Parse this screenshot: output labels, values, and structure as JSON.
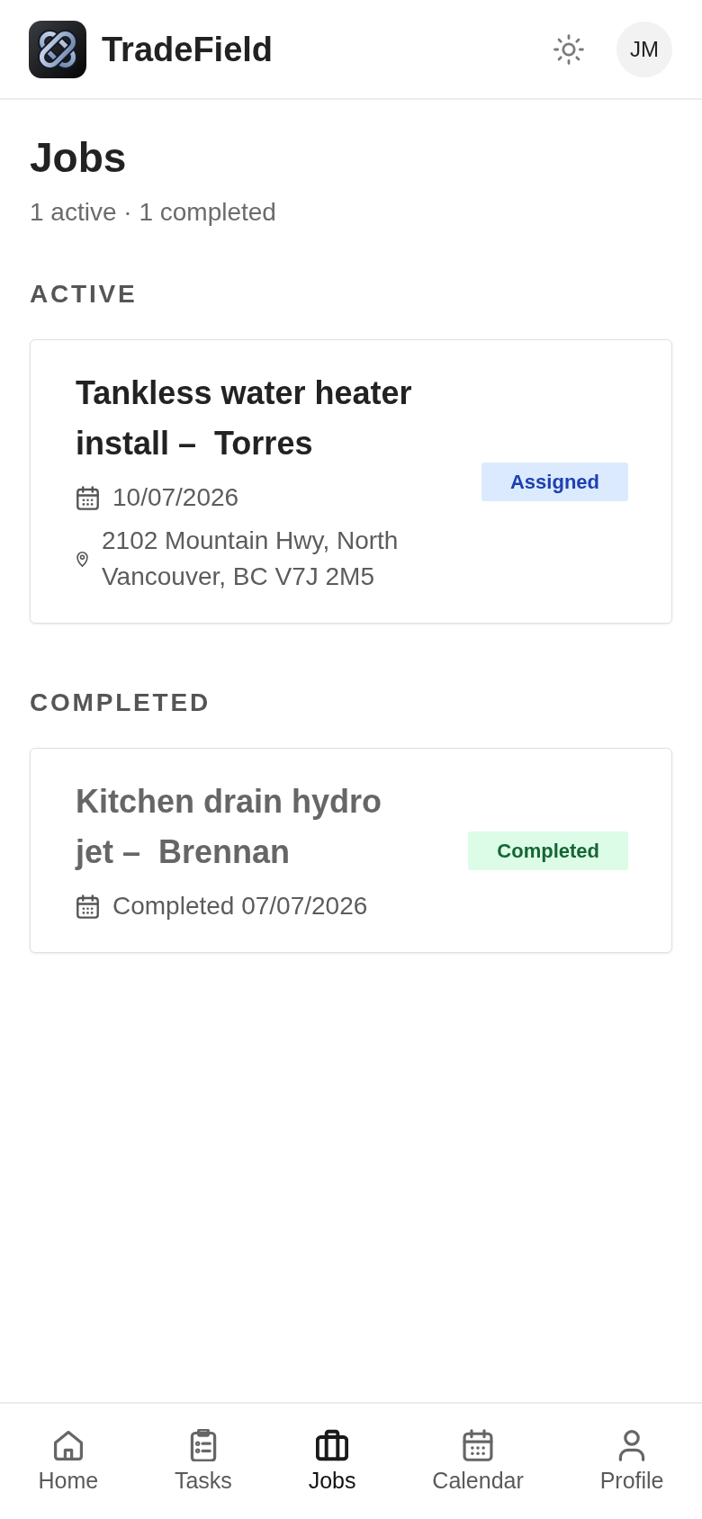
{
  "header": {
    "app_name": "TradeField",
    "avatar_initials": "JM"
  },
  "page": {
    "title": "Jobs",
    "summary": "1 active · 1 completed"
  },
  "sections": [
    {
      "heading": "ACTIVE",
      "jobs": [
        {
          "title": "Tankless water heater install –  Torres",
          "completed": false,
          "date": "10/07/2026",
          "address": "2102 Mountain Hwy, North Vancouver, BC V7J 2M5",
          "status": {
            "label": "Assigned",
            "kind": "assigned"
          }
        }
      ]
    },
    {
      "heading": "COMPLETED",
      "jobs": [
        {
          "title": "Kitchen drain hydro jet –  Brennan",
          "completed": true,
          "date": "Completed 07/07/2026",
          "status": {
            "label": "Completed",
            "kind": "completed"
          }
        }
      ]
    }
  ],
  "bottom_nav": [
    {
      "label": "Home",
      "selected": false
    },
    {
      "label": "Tasks",
      "selected": false
    },
    {
      "label": "Jobs",
      "selected": true
    },
    {
      "label": "Calendar",
      "selected": false
    },
    {
      "label": "Profile",
      "selected": false
    }
  ]
}
